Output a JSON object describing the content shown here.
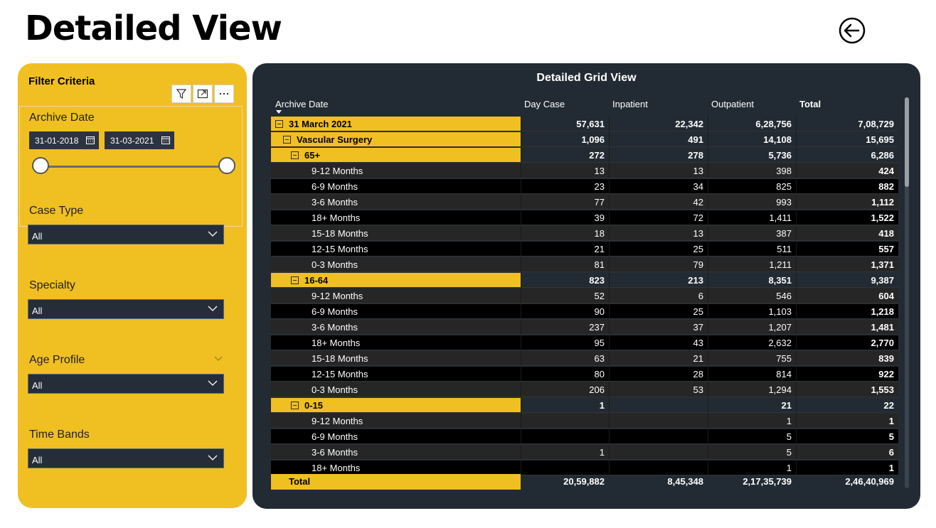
{
  "page": {
    "title": "Detailed View",
    "back_icon": "back-arrow-circle-icon"
  },
  "filter": {
    "title": "Filter Criteria",
    "archive_date": {
      "label": "Archive Date",
      "from": "31-01-2018",
      "to": "31-03-2021"
    },
    "case_type": {
      "label": "Case Type",
      "value": "All"
    },
    "specialty": {
      "label": "Specialty",
      "value": "All"
    },
    "age_profile": {
      "label": "Age Profile",
      "value": "All"
    },
    "time_bands": {
      "label": "Time Bands",
      "value": "All"
    }
  },
  "grid": {
    "title": "Detailed Grid View",
    "columns": [
      "Archive Date",
      "Day Case",
      "Inpatient",
      "Outpatient",
      "Total"
    ],
    "rows": [
      {
        "style": "lvl",
        "indent": 0,
        "label": "31 March 2021",
        "v": [
          "57,631",
          "22,342",
          "6,28,756",
          "7,08,729"
        ]
      },
      {
        "style": "lvl",
        "indent": 1,
        "label": "Vascular Surgery",
        "v": [
          "1,096",
          "491",
          "14,108",
          "15,695"
        ]
      },
      {
        "style": "lvl",
        "indent": 2,
        "label": "65+",
        "v": [
          "272",
          "278",
          "5,736",
          "6,286"
        ]
      },
      {
        "style": "light",
        "label": "9-12 Months",
        "v": [
          "13",
          "13",
          "398",
          "424"
        ]
      },
      {
        "style": "dark",
        "label": "6-9 Months",
        "v": [
          "23",
          "34",
          "825",
          "882"
        ]
      },
      {
        "style": "light",
        "label": "3-6 Months",
        "v": [
          "77",
          "42",
          "993",
          "1,112"
        ]
      },
      {
        "style": "dark",
        "label": "18+ Months",
        "v": [
          "39",
          "72",
          "1,411",
          "1,522"
        ]
      },
      {
        "style": "light",
        "label": "15-18 Months",
        "v": [
          "18",
          "13",
          "387",
          "418"
        ]
      },
      {
        "style": "dark",
        "label": "12-15 Months",
        "v": [
          "21",
          "25",
          "511",
          "557"
        ]
      },
      {
        "style": "light",
        "label": "0-3 Months",
        "v": [
          "81",
          "79",
          "1,211",
          "1,371"
        ]
      },
      {
        "style": "lvl",
        "indent": 2,
        "label": "16-64",
        "v": [
          "823",
          "213",
          "8,351",
          "9,387"
        ]
      },
      {
        "style": "light",
        "label": "9-12 Months",
        "v": [
          "52",
          "6",
          "546",
          "604"
        ]
      },
      {
        "style": "dark",
        "label": "6-9 Months",
        "v": [
          "90",
          "25",
          "1,103",
          "1,218"
        ]
      },
      {
        "style": "light",
        "label": "3-6 Months",
        "v": [
          "237",
          "37",
          "1,207",
          "1,481"
        ]
      },
      {
        "style": "dark",
        "label": "18+ Months",
        "v": [
          "95",
          "43",
          "2,632",
          "2,770"
        ]
      },
      {
        "style": "light",
        "label": "15-18 Months",
        "v": [
          "63",
          "21",
          "755",
          "839"
        ]
      },
      {
        "style": "dark",
        "label": "12-15 Months",
        "v": [
          "80",
          "28",
          "814",
          "922"
        ]
      },
      {
        "style": "light",
        "label": "0-3 Months",
        "v": [
          "206",
          "53",
          "1,294",
          "1,553"
        ]
      },
      {
        "style": "lvl",
        "indent": 2,
        "label": "0-15",
        "v": [
          "1",
          "",
          "21",
          "22"
        ]
      },
      {
        "style": "light",
        "label": "9-12 Months",
        "v": [
          "",
          "",
          "1",
          "1"
        ]
      },
      {
        "style": "dark",
        "label": "6-9 Months",
        "v": [
          "",
          "",
          "5",
          "5"
        ]
      },
      {
        "style": "light",
        "label": "3-6 Months",
        "v": [
          "1",
          "",
          "5",
          "6"
        ]
      },
      {
        "style": "dark",
        "label": "18+ Months",
        "v": [
          "",
          "",
          "1",
          "1"
        ]
      }
    ],
    "total": {
      "label": "Total",
      "v": [
        "20,59,882",
        "8,45,348",
        "2,17,35,739",
        "2,46,40,969"
      ]
    }
  }
}
